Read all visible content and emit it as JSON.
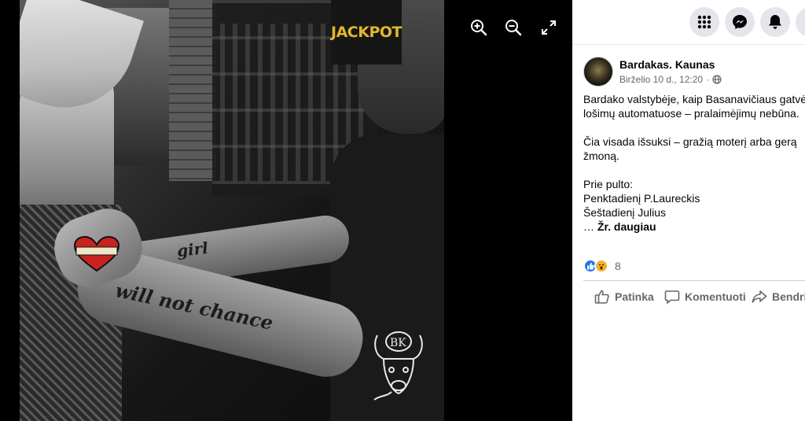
{
  "viewer": {
    "photo_text": {
      "jackpot": "JACKPOT",
      "tattoo_1": "girl",
      "tattoo_2": "will not chance"
    },
    "tools": {
      "zoom_in": "zoom-in-icon",
      "zoom_out": "zoom-out-icon",
      "fullscreen": "fullscreen-icon"
    }
  },
  "topbar": {
    "buttons": [
      "menu-grid-icon",
      "messenger-icon",
      "notifications-bell-icon"
    ]
  },
  "post": {
    "author": "Bardakas. Kaunas",
    "date": "Birželio 10 d., 12:20",
    "audience_icon": "globe-icon",
    "lines": [
      "Bardako valstybėje, kaip Basanavičiaus gatvės",
      "lošimų automatuose – pralaimėjimų nebūna.",
      "",
      "Čia visada išsuksi – gražią moterį arba gerą",
      "žmoną.",
      "",
      "Prie pulto:",
      "Penktadienį P.Laureckis",
      "Šeštadienį Julius"
    ],
    "ellipsis": "… ",
    "see_more": "Žr. daugiau",
    "reaction_count": "8",
    "actions": {
      "like": "Patinka",
      "comment": "Komentuoti",
      "share": "Bendrinti"
    }
  },
  "colors": {
    "accent": "#1877f2",
    "viewer_bg": "#000000",
    "jackpot_text": "#e3b72c"
  }
}
